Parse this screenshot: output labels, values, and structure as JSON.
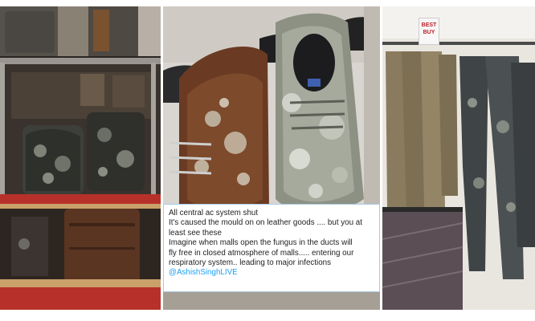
{
  "panels": [
    {
      "name": "store-shelf-mouldy-bags",
      "description_hidden": true
    },
    {
      "name": "mouldy-leather-shoes"
    },
    {
      "name": "mouldy-trousers-rack"
    }
  ],
  "store_sign": {
    "line1": "BEST",
    "line2": "BUY"
  },
  "tweet": {
    "lines": [
      "All central ac system shut",
      "It's caused the mould on on leather goods .... but you at",
      "least see these",
      "Imagine when malls open the fungus in the ducts will",
      "fly free in closed atmosphere of malls..... entering our",
      "respiratory system.. leading to major infections"
    ],
    "handle": "@AshishSinghLIVE"
  },
  "colors": {
    "tweet_border": "#a9c9e6",
    "handle": "#1da1f2",
    "mould": "#cfd2c8",
    "leather": "#6b3a22",
    "shelf_red": "#c0202a"
  }
}
